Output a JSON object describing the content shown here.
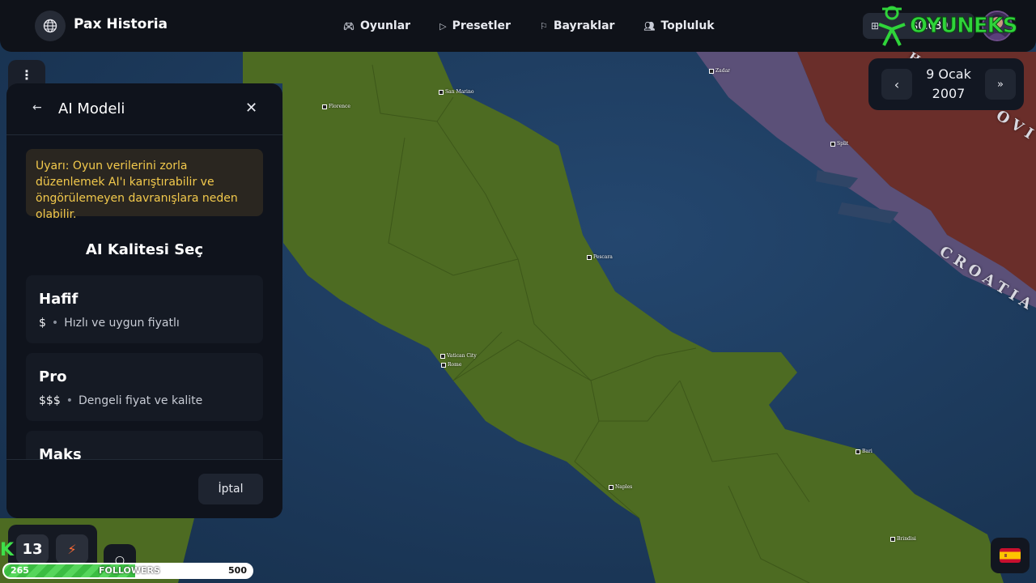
{
  "app": {
    "brand": "Pax Historia",
    "logo_icon": "globe-icon"
  },
  "nav": {
    "items": [
      {
        "label": "Oyunlar",
        "icon": "gamepad-icon"
      },
      {
        "label": "Presetler",
        "icon": "play-icon"
      },
      {
        "label": "Bayraklar",
        "icon": "flag-icon"
      },
      {
        "label": "Topluluk",
        "icon": "users-icon"
      }
    ]
  },
  "account": {
    "credit": "$0.039",
    "credit_icon": "gift-icon"
  },
  "watermark": {
    "text": "OYUNEKS"
  },
  "date": {
    "day": "9 Ocak",
    "year": "2007",
    "prev_icon": "chevron-left-icon",
    "next_icon": "double-chevron-right-icon"
  },
  "map": {
    "region_labels": {
      "croatia": "CROATIA",
      "bosnia": "OVI",
      "herceg": "HE"
    },
    "cities": [
      {
        "name": "Florence"
      },
      {
        "name": "San Marino"
      },
      {
        "name": "Vatican City"
      },
      {
        "name": "Rome"
      },
      {
        "name": "Naples"
      },
      {
        "name": "Pescara"
      },
      {
        "name": "Bari"
      },
      {
        "name": "Split"
      },
      {
        "name": "Zadar"
      },
      {
        "name": "Brindisi"
      }
    ],
    "colors": {
      "sea": "#1c3a5e",
      "italy": "#4d6e23",
      "croatia": "#6e2c28",
      "coast": "#5f527c"
    }
  },
  "panel": {
    "title": "AI Modeli",
    "back_icon": "arrow-left-icon",
    "close_icon": "close-icon",
    "warning": "Uyarı: Oyun verilerini zorla düzenlemek AI'ı karıştırabilir ve öngörülemeyen davranışlara neden olabilir.",
    "section_title": "AI Kalitesi Seç",
    "options": [
      {
        "name": "Hafif",
        "price": "$",
        "desc": "Hızlı ve uygun fiyatlı"
      },
      {
        "name": "Pro",
        "price": "$$$",
        "desc": "Dengeli fiyat ve kalite"
      },
      {
        "name": "Maks",
        "price": "",
        "desc": ""
      }
    ],
    "cancel_label": "İptal"
  },
  "overlay": {
    "counter": "13",
    "k_letter": "K",
    "bolt_icon": "lightning-icon",
    "followers_label": "FOLLOWERS",
    "followers_current": "265",
    "followers_goal": "500",
    "followers_progress": 0.53
  },
  "language": {
    "flag": "spain-flag-icon"
  }
}
